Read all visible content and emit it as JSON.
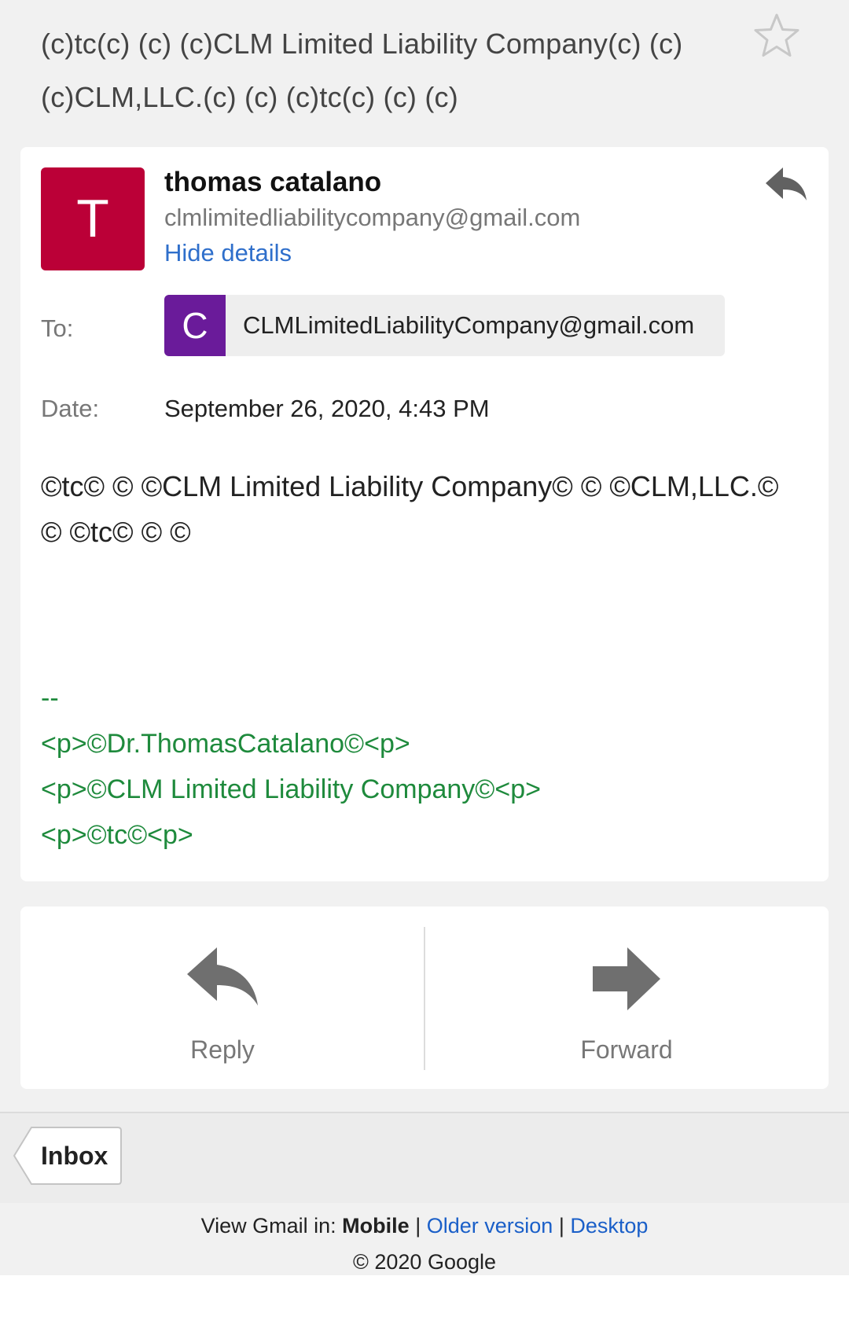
{
  "subject": {
    "line1": "(c)tc(c) (c) (c)CLM Limited Liability Company(c) (c)",
    "line2": "(c)CLM,LLC.(c) (c) (c)tc(c) (c) (c)"
  },
  "sender": {
    "avatar_letter": "T",
    "name": "thomas catalano",
    "email": "clmlimitedliabilitycompany@gmail.com",
    "hide_details": "Hide details"
  },
  "details": {
    "to_label": "To:",
    "recipient_avatar_letter": "C",
    "recipient_email": "CLMLimitedLiabilityCompany@gmail.com",
    "date_label": "Date:",
    "date_value": "September 26, 2020, 4:43 PM"
  },
  "body": {
    "line1": "©tc© © ©CLM Limited Liability Company© © ©CLM,LLC.©",
    "line2": "© ©tc© © ©"
  },
  "signature": {
    "separator": "--",
    "line1": "<p>©Dr.ThomasCatalano©<p>",
    "line2": "<p>©CLM Limited Liability Company©<p>",
    "line3": "<p>©tc©<p>"
  },
  "actions": {
    "reply_label": "Reply",
    "forward_label": "Forward"
  },
  "nav": {
    "inbox_label": "Inbox"
  },
  "footer": {
    "view_in": "View Gmail in:",
    "mobile": "Mobile",
    "sep": "|",
    "older": "Older version",
    "desktop": "Desktop",
    "copyright": "© 2020 Google"
  },
  "colors": {
    "sender_avatar": "#bb0037",
    "recipient_avatar": "#6a1b9a",
    "link": "#2f6fcb",
    "signature": "#1e8a3c"
  },
  "icons": {
    "star": "star-outline-icon",
    "reply": "reply-arrow-icon",
    "forward": "forward-arrow-icon",
    "inbox": "back-chevron-icon"
  }
}
